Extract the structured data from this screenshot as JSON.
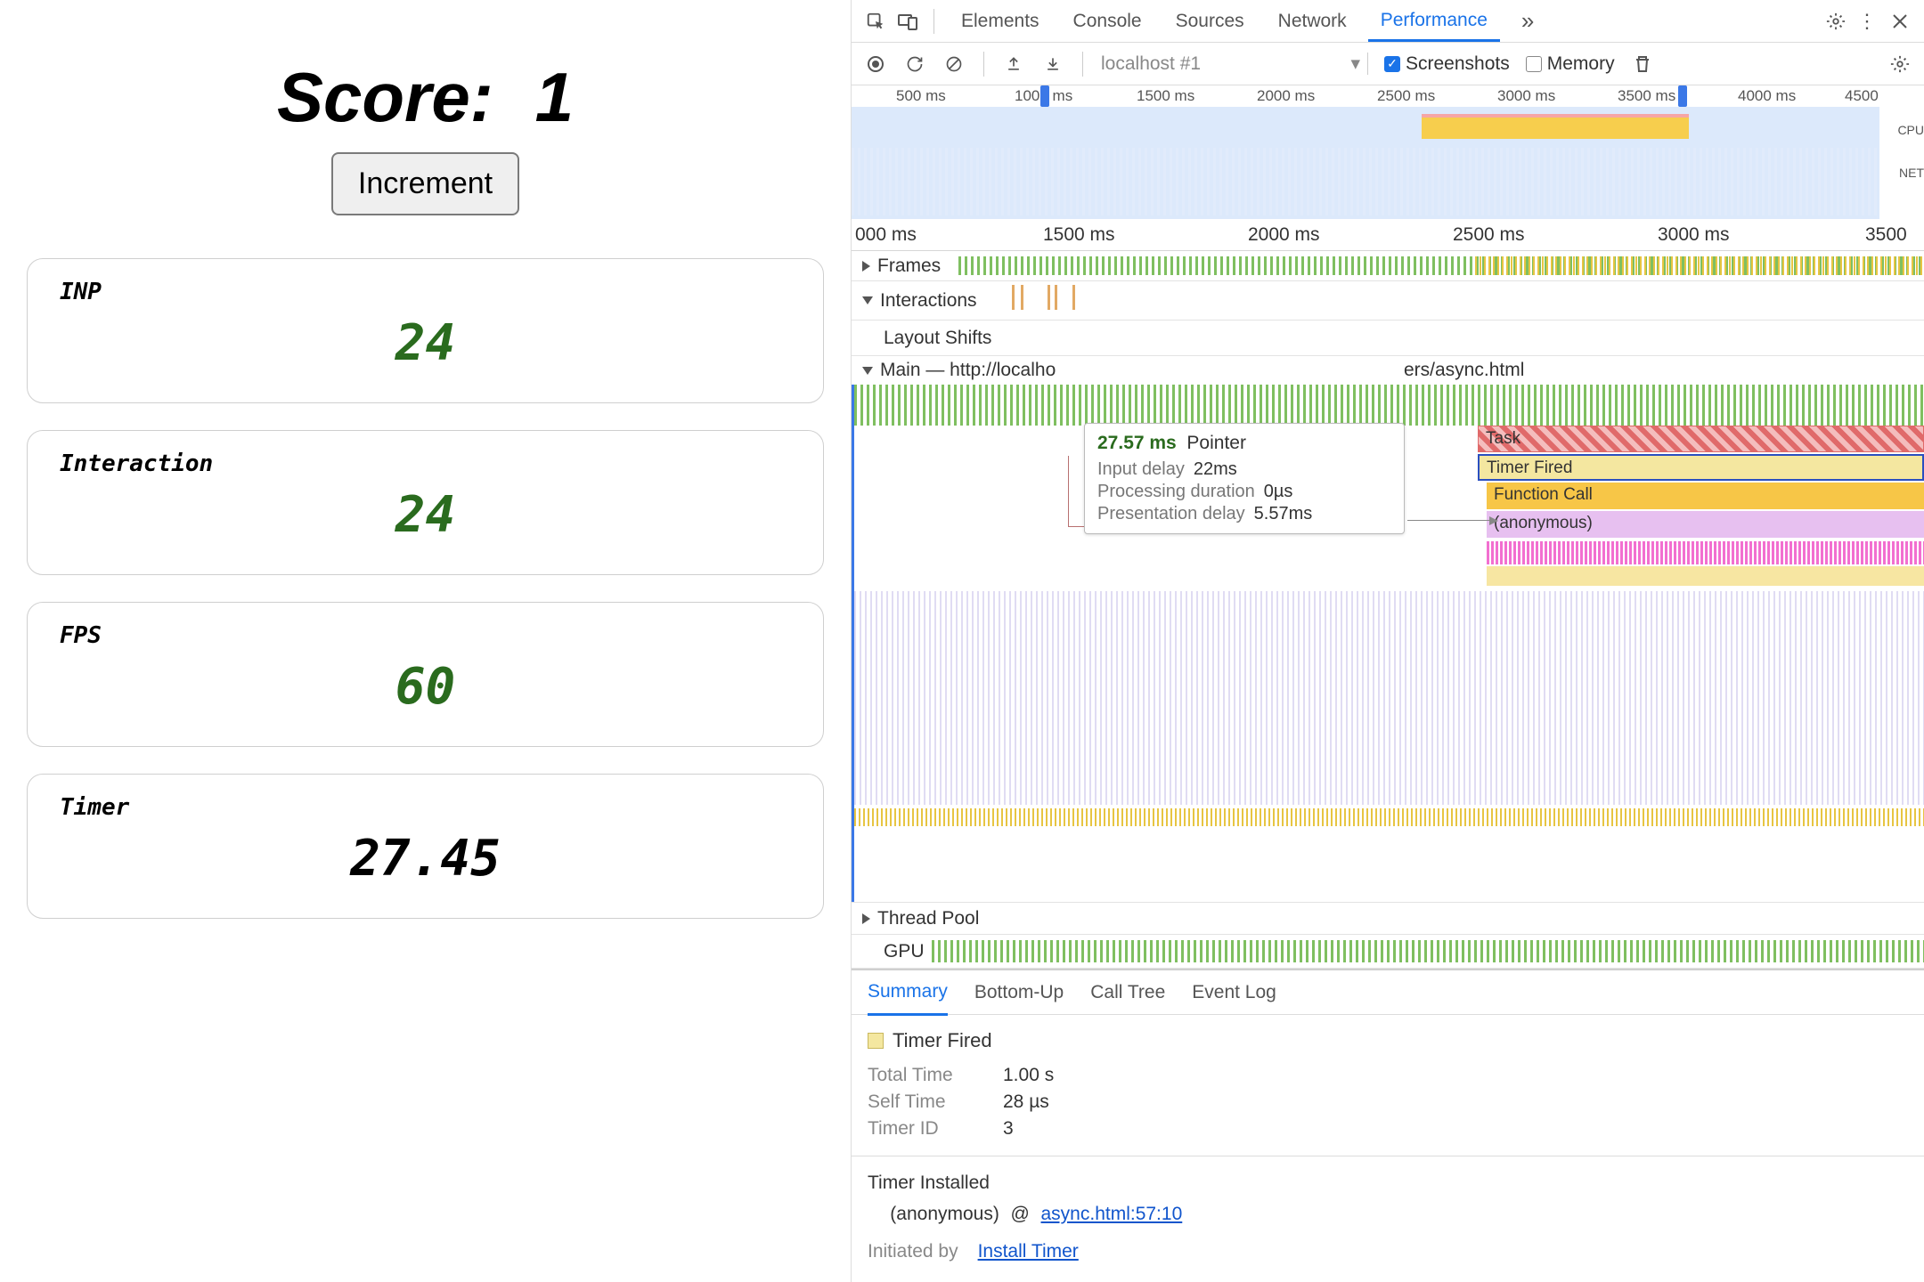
{
  "left": {
    "score_label": "Score:",
    "score_value": "1",
    "increment": "Increment",
    "cards": {
      "inp": {
        "label": "INP",
        "value": "24"
      },
      "interaction": {
        "label": "Interaction",
        "value": "24"
      },
      "fps": {
        "label": "FPS",
        "value": "60"
      },
      "timer": {
        "label": "Timer",
        "value": "27.45"
      }
    }
  },
  "devtools": {
    "tabs": {
      "elements": "Elements",
      "console": "Console",
      "sources": "Sources",
      "network": "Network",
      "performance": "Performance",
      "more": "»"
    },
    "toolbar": {
      "context": "localhost #1",
      "screenshots_label": "Screenshots",
      "screenshots_checked": true,
      "memory_label": "Memory",
      "memory_checked": false
    },
    "overview": {
      "ticks": [
        "500 ms",
        "1000 ms",
        "1500 ms",
        "2000 ms",
        "2500 ms",
        "3000 ms",
        "3500 ms",
        "4000 ms",
        "4500"
      ],
      "side": {
        "cpu": "CPU",
        "net": "NET"
      }
    },
    "timeline": {
      "ruler": [
        "000 ms",
        "1500 ms",
        "2000 ms",
        "2500 ms",
        "3000 ms",
        "3500"
      ],
      "lanes": {
        "frames": "Frames",
        "interactions": "Interactions",
        "layout_shifts": "Layout Shifts",
        "main": "Main — http://localho",
        "main_suffix": "ers/async.html",
        "thread_pool": "Thread Pool",
        "gpu": "GPU"
      },
      "segments": {
        "task": "Task",
        "timer_fired": "Timer Fired",
        "function_call": "Function Call",
        "anonymous": "(anonymous)"
      }
    },
    "tooltip": {
      "duration": "27.57 ms",
      "name": "Pointer",
      "rows": [
        [
          "Input delay",
          "22ms"
        ],
        [
          "Processing duration",
          "0µs"
        ],
        [
          "Presentation delay",
          "5.57ms"
        ]
      ]
    },
    "bottom": {
      "tabs": {
        "summary": "Summary",
        "bottom_up": "Bottom-Up",
        "call_tree": "Call Tree",
        "event_log": "Event Log"
      },
      "event": "Timer Fired",
      "kv": [
        [
          "Total Time",
          "1.00 s"
        ],
        [
          "Self Time",
          "28 µs"
        ],
        [
          "Timer ID",
          "3"
        ]
      ],
      "installed": "Timer Installed",
      "frame_fn": "(anonymous)",
      "frame_at": "@",
      "frame_loc": "async.html:57:10",
      "initiated_label": "Initiated by",
      "initiated_link": "Install Timer"
    }
  }
}
